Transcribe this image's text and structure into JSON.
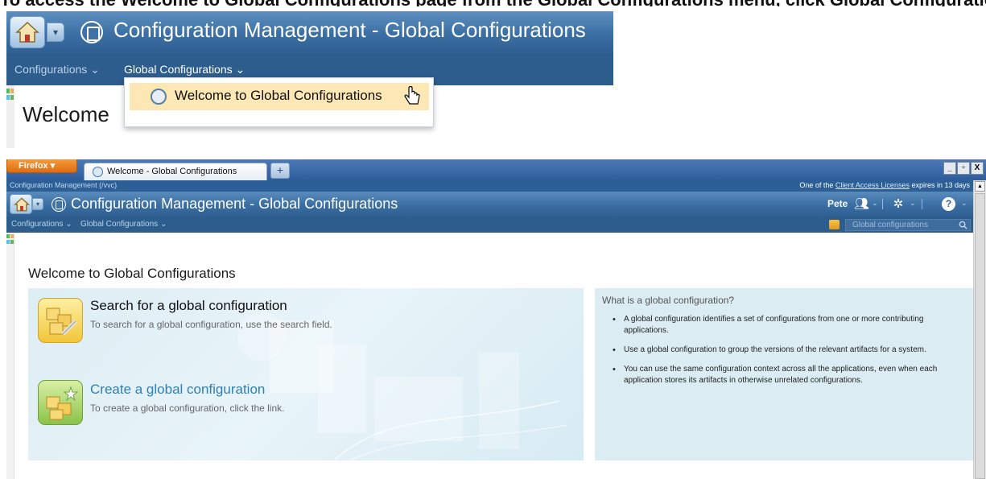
{
  "caption": {
    "text": "To access the Welcome to Global Configurations page from the Global Configurations menu, click Global Configurations > Welcome to Global Configurations."
  },
  "inset": {
    "title": "Configuration Management - Global Configurations",
    "menu": {
      "configurations": "Configurations ⌄",
      "global_configurations": "Global Configurations ⌄"
    },
    "popup_item": "Welcome to Global Configurations",
    "welcome_text": "Welcome"
  },
  "browser": {
    "firefox_button": "Firefox ▾",
    "tab_title": "Welcome - Global Configurations",
    "new_tab": "+",
    "window_controls": [
      "_",
      "▫",
      "X"
    ]
  },
  "infobar": {
    "left": "Configuration Management (/vvc)",
    "license_prefix": "One of the ",
    "license_link": "Client Access Licenses",
    "license_suffix": " expires in 13 days"
  },
  "banner": {
    "title": "Configuration Management - Global Configurations",
    "user": "Pete",
    "icons": [
      "home-icon",
      "people-icon",
      "gear-icon",
      "help-icon"
    ]
  },
  "menubar": {
    "configurations": "Configurations ⌄",
    "global_configurations": "Global Configurations ⌄",
    "search_placeholder": "Global configurations"
  },
  "page": {
    "heading": "Welcome to Global Configurations",
    "search_title": "Search for a global configuration",
    "search_desc": "To search for a global configuration, use the search field.",
    "create_title": "Create a global configuration",
    "create_desc": "To create a global configuration, click the link.",
    "info_title": "What is a global configuration?",
    "info_items": [
      "A global configuration identifies a set of configurations from one or more contributing applications.",
      "Use a global configuration to group the versions of the relevant artifacts for a system.",
      "You can use the same configuration context across all the applications, even when each application stores its artifacts in otherwise unrelated configurations."
    ]
  },
  "colors": {
    "banner": "#3a6ea2",
    "menubar": "#2d5d8d",
    "link": "#2f7fb5",
    "highlight": "#fde7b4",
    "panel": "#dbecf3"
  }
}
